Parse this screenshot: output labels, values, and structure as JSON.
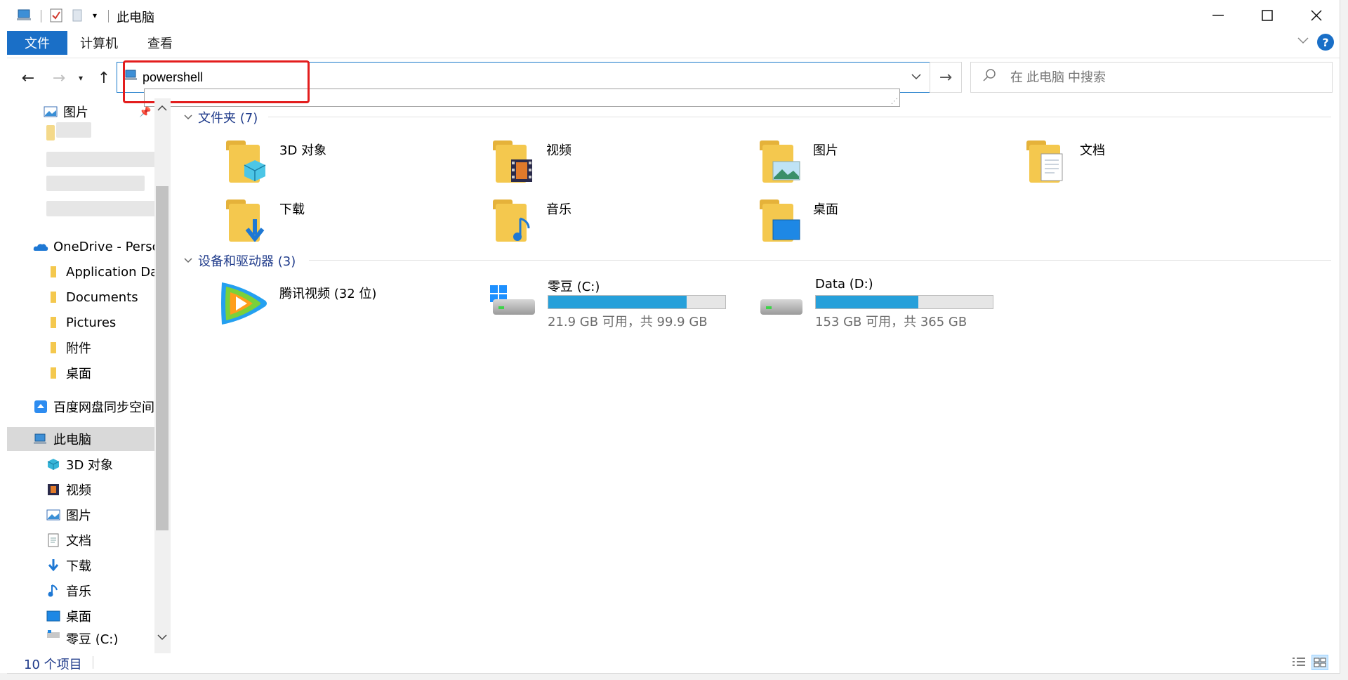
{
  "window": {
    "title": "此电脑"
  },
  "ribbon": {
    "file_label": "文件",
    "tabs": [
      "计算机",
      "查看"
    ],
    "help_label": "?"
  },
  "address": {
    "value": "powershell"
  },
  "search": {
    "placeholder": "在 此电脑 中搜索"
  },
  "sidebar": {
    "items": [
      {
        "label": "图片",
        "icon": "pictures-icon"
      },
      {
        "label": "OneDrive - Perso",
        "icon": "onedrive-icon"
      },
      {
        "label": "Application Da",
        "icon": "folder-icon"
      },
      {
        "label": "Documents",
        "icon": "folder-icon"
      },
      {
        "label": "Pictures",
        "icon": "folder-icon"
      },
      {
        "label": "附件",
        "icon": "folder-icon"
      },
      {
        "label": "桌面",
        "icon": "folder-icon"
      },
      {
        "label": "百度网盘同步空间",
        "icon": "baidu-sync-icon"
      },
      {
        "label": "此电脑",
        "icon": "computer-icon"
      },
      {
        "label": "3D 对象",
        "icon": "cube-icon"
      },
      {
        "label": "视频",
        "icon": "video-icon"
      },
      {
        "label": "图片",
        "icon": "pictures-icon"
      },
      {
        "label": "文档",
        "icon": "document-icon"
      },
      {
        "label": "下载",
        "icon": "download-icon"
      },
      {
        "label": "音乐",
        "icon": "music-icon"
      },
      {
        "label": "桌面",
        "icon": "desktop-icon"
      },
      {
        "label": "零豆 (C:)",
        "icon": "drive-c-icon"
      }
    ]
  },
  "main": {
    "folders_header": "文件夹 (7)",
    "folders": [
      {
        "label": "3D 对象",
        "icon": "cube-icon"
      },
      {
        "label": "视频",
        "icon": "video-icon"
      },
      {
        "label": "图片",
        "icon": "pictures-icon"
      },
      {
        "label": "文档",
        "icon": "document-icon"
      },
      {
        "label": "下载",
        "icon": "download-icon"
      },
      {
        "label": "音乐",
        "icon": "music-icon"
      },
      {
        "label": "桌面",
        "icon": "desktop-icon"
      }
    ],
    "devices_header": "设备和驱动器 (3)",
    "devices": [
      {
        "label": "腾讯视频 (32 位)",
        "icon": "tencent-video-icon"
      },
      {
        "label": "零豆 (C:)",
        "icon": "windows-drive-icon",
        "free_text": "21.9 GB 可用，共 99.9 GB",
        "used_fraction": 0.78
      },
      {
        "label": "Data (D:)",
        "icon": "hdd-icon",
        "free_text": "153 GB 可用，共 365 GB",
        "used_fraction": 0.58
      }
    ]
  },
  "status": {
    "text": "10 个项目"
  },
  "colors": {
    "accent": "#1a6fc7",
    "highlight": "#e31d1d",
    "drive_fill": "#26a0da",
    "folder": "#f4c84e"
  }
}
